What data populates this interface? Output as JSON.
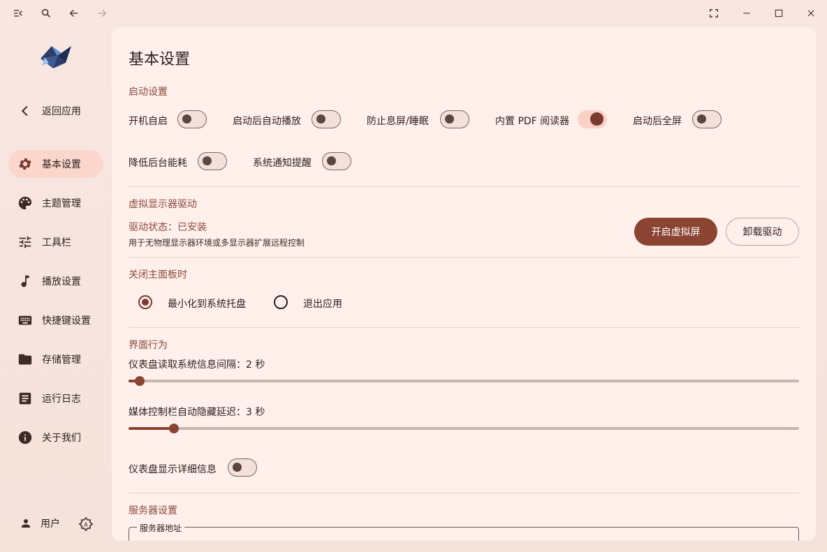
{
  "sidebar": {
    "back_label": "返回应用",
    "items": [
      {
        "label": "基本设置",
        "icon": "gear-icon"
      },
      {
        "label": "主题管理",
        "icon": "palette-icon"
      },
      {
        "label": "工具栏",
        "icon": "tune-icon"
      },
      {
        "label": "播放设置",
        "icon": "music-note-icon"
      },
      {
        "label": "快捷键设置",
        "icon": "keyboard-icon"
      },
      {
        "label": "存储管理",
        "icon": "folder-icon"
      },
      {
        "label": "运行日志",
        "icon": "log-icon"
      },
      {
        "label": "关于我们",
        "icon": "info-icon"
      }
    ],
    "active": "基本设置",
    "user_label": "用户"
  },
  "main": {
    "title": "基本设置",
    "startup": {
      "section_title": "启动设置",
      "switches": [
        {
          "label": "开机自启",
          "on": false
        },
        {
          "label": "启动后自动播放",
          "on": false
        },
        {
          "label": "防止息屏/睡眠",
          "on": false
        },
        {
          "label": "内置 PDF 阅读器",
          "on": true
        },
        {
          "label": "启动后全屏",
          "on": false
        },
        {
          "label": "降低后台能耗",
          "on": false
        },
        {
          "label": "系统通知提醒",
          "on": false
        }
      ]
    },
    "virtual_display": {
      "section_title": "虚拟显示器驱动",
      "status": "驱动状态：已安装",
      "description": "用于无物理显示器环境或多显示器扩展远程控制",
      "primary_button": "开启虚拟屏",
      "secondary_button": "卸载驱动"
    },
    "close_behavior": {
      "section_title": "关闭主面板时",
      "options": [
        {
          "label": "最小化到系统托盘",
          "checked": true
        },
        {
          "label": "退出应用",
          "checked": false
        }
      ]
    },
    "ui_behavior": {
      "section_title": "界面行为",
      "sliders": [
        {
          "label": "仪表盘读取系统信息间隔：2 秒",
          "fraction": 0.017
        },
        {
          "label": "媒体控制栏自动隐藏延迟：3 秒",
          "fraction": 0.068
        }
      ],
      "detail_switch": {
        "label": "仪表盘显示详细信息",
        "on": false
      }
    },
    "server": {
      "section_title": "服务器设置",
      "address_label": "服务器地址",
      "address_value": ""
    }
  },
  "colors": {
    "accent": "#8b4332",
    "section_title": "#8b4a3c",
    "active_nav": "#fbd6cc",
    "panel_bg": "#fff0ec"
  }
}
